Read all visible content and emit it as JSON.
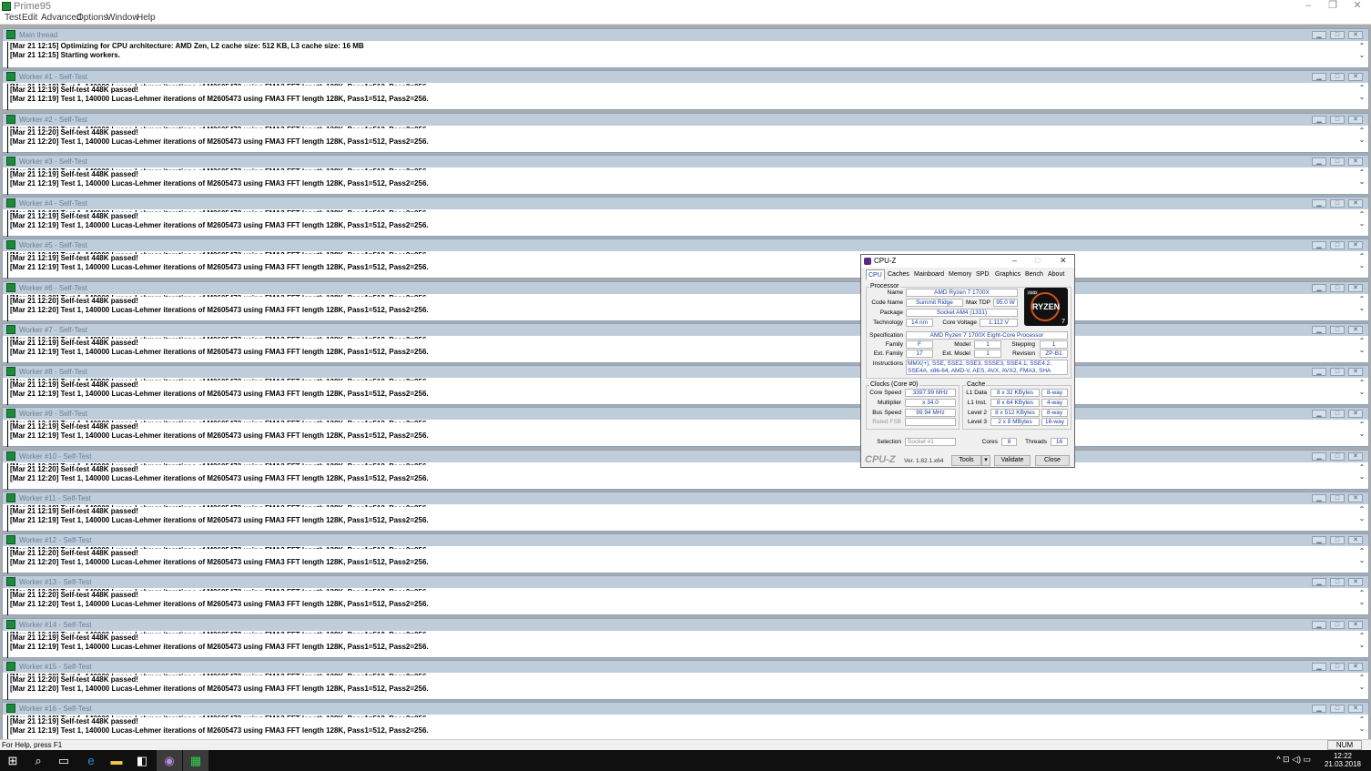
{
  "app": {
    "title": "Prime95",
    "controls": {
      "minimize": "–",
      "restore": "❐",
      "close": "✕"
    }
  },
  "menu": [
    "Test",
    "Edit",
    "Advanced",
    "Options",
    "Window",
    "Help"
  ],
  "windows": [
    {
      "title": "Main thread",
      "lines": [
        "[Mar 21 12:15] Optimizing for CPU architecture: AMD Zen, L2 cache size: 512 KB, L3 cache size: 16 MB",
        "[Mar 21 12:15] Starting workers."
      ]
    },
    {
      "title": "Worker #1 - Self-Test",
      "lines": [
        "[Mar 21 12:19] Self-test 448K passed!",
        "[Mar 21 12:19] Test 1, 140000 Lucas-Lehmer iterations of M2605473 using FMA3 FFT length 128K, Pass1=512, Pass2=256."
      ]
    },
    {
      "title": "Worker #2 - Self-Test",
      "lines": [
        "[Mar 21 12:20] Self-test 448K passed!",
        "[Mar 21 12:20] Test 1, 140000 Lucas-Lehmer iterations of M2605473 using FMA3 FFT length 128K, Pass1=512, Pass2=256."
      ]
    },
    {
      "title": "Worker #3 - Self-Test",
      "lines": [
        "[Mar 21 12:19] Self-test 448K passed!",
        "[Mar 21 12:19] Test 1, 140000 Lucas-Lehmer iterations of M2605473 using FMA3 FFT length 128K, Pass1=512, Pass2=256."
      ]
    },
    {
      "title": "Worker #4 - Self-Test",
      "lines": [
        "[Mar 21 12:19] Self-test 448K passed!",
        "[Mar 21 12:19] Test 1, 140000 Lucas-Lehmer iterations of M2605473 using FMA3 FFT length 128K, Pass1=512, Pass2=256."
      ]
    },
    {
      "title": "Worker #5 - Self-Test",
      "lines": [
        "[Mar 21 12:19] Self-test 448K passed!",
        "[Mar 21 12:19] Test 1, 140000 Lucas-Lehmer iterations of M2605473 using FMA3 FFT length 128K, Pass1=512, Pass2=256."
      ]
    },
    {
      "title": "Worker #6 - Self-Test",
      "lines": [
        "[Mar 21 12:20] Self-test 448K passed!",
        "[Mar 21 12:20] Test 1, 140000 Lucas-Lehmer iterations of M2605473 using FMA3 FFT length 128K, Pass1=512, Pass2=256."
      ]
    },
    {
      "title": "Worker #7 - Self-Test",
      "lines": [
        "[Mar 21 12:19] Self-test 448K passed!",
        "[Mar 21 12:19] Test 1, 140000 Lucas-Lehmer iterations of M2605473 using FMA3 FFT length 128K, Pass1=512, Pass2=256."
      ]
    },
    {
      "title": "Worker #8 - Self-Test",
      "lines": [
        "[Mar 21 12:19] Self-test 448K passed!",
        "[Mar 21 12:19] Test 1, 140000 Lucas-Lehmer iterations of M2605473 using FMA3 FFT length 128K, Pass1=512, Pass2=256."
      ]
    },
    {
      "title": "Worker #9 - Self-Test",
      "lines": [
        "[Mar 21 12:19] Self-test 448K passed!",
        "[Mar 21 12:19] Test 1, 140000 Lucas-Lehmer iterations of M2605473 using FMA3 FFT length 128K, Pass1=512, Pass2=256."
      ]
    },
    {
      "title": "Worker #10 - Self-Test",
      "lines": [
        "[Mar 21 12:20] Self-test 448K passed!",
        "[Mar 21 12:20] Test 1, 140000 Lucas-Lehmer iterations of M2605473 using FMA3 FFT length 128K, Pass1=512, Pass2=256."
      ]
    },
    {
      "title": "Worker #11 - Self-Test",
      "lines": [
        "[Mar 21 12:19] Self-test 448K passed!",
        "[Mar 21 12:19] Test 1, 140000 Lucas-Lehmer iterations of M2605473 using FMA3 FFT length 128K, Pass1=512, Pass2=256."
      ]
    },
    {
      "title": "Worker #12 - Self-Test",
      "lines": [
        "[Mar 21 12:20] Self-test 448K passed!",
        "[Mar 21 12:20] Test 1, 140000 Lucas-Lehmer iterations of M2605473 using FMA3 FFT length 128K, Pass1=512, Pass2=256."
      ]
    },
    {
      "title": "Worker #13 - Self-Test",
      "lines": [
        "[Mar 21 12:20] Self-test 448K passed!",
        "[Mar 21 12:20] Test 1, 140000 Lucas-Lehmer iterations of M2605473 using FMA3 FFT length 128K, Pass1=512, Pass2=256."
      ]
    },
    {
      "title": "Worker #14 - Self-Test",
      "lines": [
        "[Mar 21 12:19] Self-test 448K passed!",
        "[Mar 21 12:19] Test 1, 140000 Lucas-Lehmer iterations of M2605473 using FMA3 FFT length 128K, Pass1=512, Pass2=256."
      ]
    },
    {
      "title": "Worker #15 - Self-Test",
      "lines": [
        "[Mar 21 12:20] Self-test 448K passed!",
        "[Mar 21 12:20] Test 1, 140000 Lucas-Lehmer iterations of M2605473 using FMA3 FFT length 128K, Pass1=512, Pass2=256."
      ]
    },
    {
      "title": "Worker #16 - Self-Test",
      "lines": [
        "[Mar 21 12:19] Self-test 448K passed!",
        "[Mar 21 12:19] Test 1, 140000 Lucas-Lehmer iterations of M2605473 using FMA3 FFT length 128K, Pass1=512, Pass2=256."
      ]
    }
  ],
  "status": {
    "help": "For Help, press F1",
    "num": "NUM"
  },
  "taskbar": {
    "icons": [
      "windows-start-icon",
      "search-icon",
      "task-view-icon",
      "edge-icon",
      "file-explorer-icon",
      "store-icon",
      "cpuz-taskbar-icon",
      "prime95-taskbar-icon"
    ],
    "tray": "^  ⊡  ◁)  ▭",
    "time": "12:22",
    "date": "21.03.2018"
  },
  "cpuz": {
    "title": "CPU-Z",
    "tabs": [
      "CPU",
      "Caches",
      "Mainboard",
      "Memory",
      "SPD",
      "Graphics",
      "Bench",
      "About"
    ],
    "processor": {
      "group": "Processor",
      "name_lbl": "Name",
      "name": "AMD Ryzen 7 1700X",
      "code_lbl": "Code Name",
      "code": "Summit Ridge",
      "tdp_lbl": "Max TDP",
      "tdp": "95.0 W",
      "package_lbl": "Package",
      "package": "Socket AM4 (1331)",
      "tech_lbl": "Technology",
      "tech": "14 nm",
      "voltage_lbl": "Core Voltage",
      "voltage": "1.112 V",
      "spec_lbl": "Specification",
      "spec": "AMD Ryzen 7 1700X Eight-Core Processor",
      "family_lbl": "Family",
      "family": "F",
      "model_lbl": "Model",
      "model": "1",
      "stepping_lbl": "Stepping",
      "stepping": "1",
      "extfam_lbl": "Ext. Family",
      "extfam": "17",
      "extmodel_lbl": "Ext. Model",
      "extmodel": "1",
      "revision_lbl": "Revision",
      "revision": "ZP-B1",
      "instr_lbl": "Instructions",
      "instr": "MMX(+), SSE, SSE2, SSE3, SSSE3, SSE4.1, SSE4.2, SSE4A, x86-64, AMD-V, AES, AVX, AVX2, FMA3, SHA"
    },
    "logo": {
      "badge": "AMD",
      "text": "RYZEN",
      "tier": "7"
    },
    "clocks": {
      "group": "Clocks (Core #0)",
      "speed_lbl": "Core Speed",
      "speed": "3397.99 MHz",
      "mult_lbl": "Multiplier",
      "mult": "x 34.0",
      "bus_lbl": "Bus Speed",
      "bus": "99.94 MHz",
      "fsb_lbl": "Rated FSB",
      "fsb": ""
    },
    "cache": {
      "group": "Cache",
      "l1d_lbl": "L1 Data",
      "l1d": "8 x 32 KBytes",
      "l1d_way": "8-way",
      "l1i_lbl": "L1 Inst.",
      "l1i": "8 x 64 KBytes",
      "l1i_way": "4-way",
      "l2_lbl": "Level 2",
      "l2": "8 x 512 KBytes",
      "l2_way": "8-way",
      "l3_lbl": "Level 3",
      "l3": "2 x 8 MBytes",
      "l3_way": "16-way"
    },
    "selection_lbl": "Selection",
    "selection": "Socket #1",
    "cores_lbl": "Cores",
    "cores": "8",
    "threads_lbl": "Threads",
    "threads": "16",
    "brand": "CPU-Z",
    "version": "Ver. 1.82.1.x64",
    "tools": "Tools",
    "validate": "Validate",
    "close": "Close"
  }
}
